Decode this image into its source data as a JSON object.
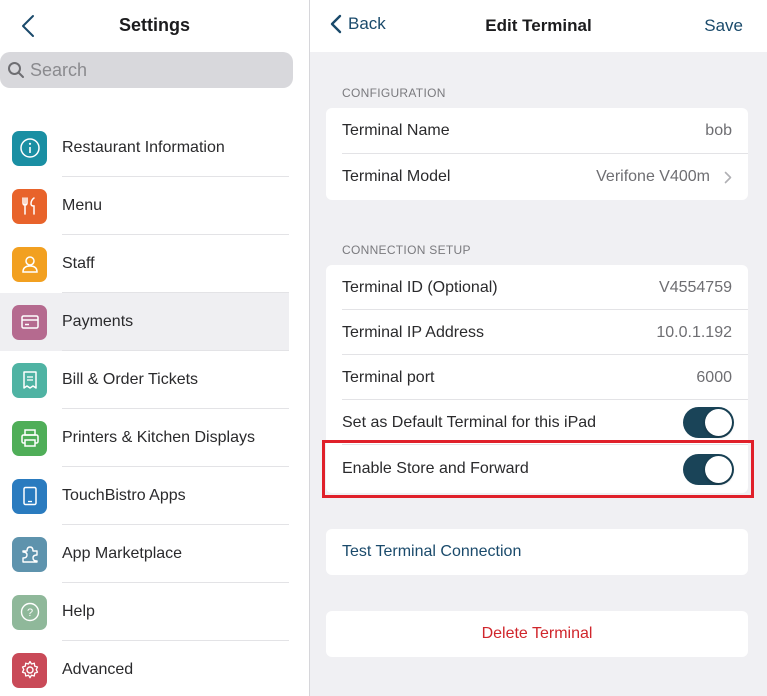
{
  "left_pane": {
    "title": "Settings",
    "search_placeholder": "Search",
    "items": [
      {
        "label": "Restaurant Information",
        "icon": "info-icon",
        "color": "#1a8fa3"
      },
      {
        "label": "Menu",
        "icon": "utensils-icon",
        "color": "#e8632b"
      },
      {
        "label": "Staff",
        "icon": "person-icon",
        "color": "#f2a020"
      },
      {
        "label": "Payments",
        "icon": "card-icon",
        "color": "#b56a8f",
        "selected": true
      },
      {
        "label": "Bill & Order Tickets",
        "icon": "receipt-icon",
        "color": "#4fb3a3"
      },
      {
        "label": "Printers & Kitchen Displays",
        "icon": "printer-icon",
        "color": "#4fae58"
      },
      {
        "label": "TouchBistro Apps",
        "icon": "tablet-icon",
        "color": "#2a7bbf"
      },
      {
        "label": "App Marketplace",
        "icon": "puzzle-icon",
        "color": "#5e93ad"
      },
      {
        "label": "Help",
        "icon": "help-icon",
        "color": "#8fb89a"
      },
      {
        "label": "Advanced",
        "icon": "gear-icon",
        "color": "#c94a58"
      }
    ]
  },
  "right_pane": {
    "back_label": "Back",
    "title": "Edit Terminal",
    "save_label": "Save",
    "configuration": {
      "section_title": "CONFIGURATION",
      "terminal_name_label": "Terminal Name",
      "terminal_name_value": "bob",
      "terminal_model_label": "Terminal Model",
      "terminal_model_value": "Verifone V400m"
    },
    "connection": {
      "section_title": "CONNECTION SETUP",
      "terminal_id_label": "Terminal ID (Optional)",
      "terminal_id_value": "V4554759",
      "ip_label": "Terminal IP Address",
      "ip_value": "10.0.1.192",
      "port_label": "Terminal port",
      "port_value": "6000",
      "default_label": "Set as Default Terminal for this iPad",
      "default_on": true,
      "store_forward_label": "Enable Store and Forward",
      "store_forward_on": true
    },
    "test_label": "Test Terminal Connection",
    "delete_label": "Delete Terminal"
  },
  "colors": {
    "accent": "#1a4a6b",
    "toggle_on": "#1a4458",
    "destructive": "#d0262c",
    "highlight": "#e0202a"
  }
}
